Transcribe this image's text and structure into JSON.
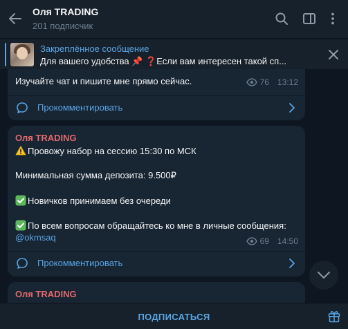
{
  "header": {
    "title": "Оля TRADING",
    "subtitle": "201 подписчик"
  },
  "pinned": {
    "title": "Закреплённое сообщение",
    "text": "Для вашего удобства 📌 ❓Если вам интересен такой сп..."
  },
  "messages": [
    {
      "text": "Изучайте чат и пишите мне прямо сейчас.",
      "views": "76",
      "time": "13:12",
      "comment_label": "Прокомментировать"
    },
    {
      "author": "Оля TRADING",
      "line1": "Провожу набор на сессию 15:30 по  МСК",
      "line2": "Минимальная сумма депозита: 9.500₽",
      "line3": "Новичков принимаем без очереди",
      "line4": "По всем вопросам обращайтесь ко мне в личные сообщения:",
      "link": "@okmsaq",
      "views": "69",
      "time": "14:50",
      "comment_label": "Прокомментировать"
    },
    {
      "author": "Оля TRADING"
    }
  ],
  "footer": {
    "subscribe_label": "ПОДПИСАТЬСЯ"
  },
  "colors": {
    "background": "#0e1621",
    "panel": "#17212b",
    "bubble": "#182533",
    "accent": "#5aa5e6",
    "author": "#e3696d",
    "muted": "#6d7f8f"
  },
  "icons": [
    "back-arrow-icon",
    "search-icon",
    "sidebar-toggle-icon",
    "more-vertical-icon",
    "close-icon",
    "eye-icon",
    "comment-icon",
    "chevron-right-icon",
    "chevron-down-icon",
    "gift-icon",
    "warning-icon",
    "check-icon"
  ]
}
